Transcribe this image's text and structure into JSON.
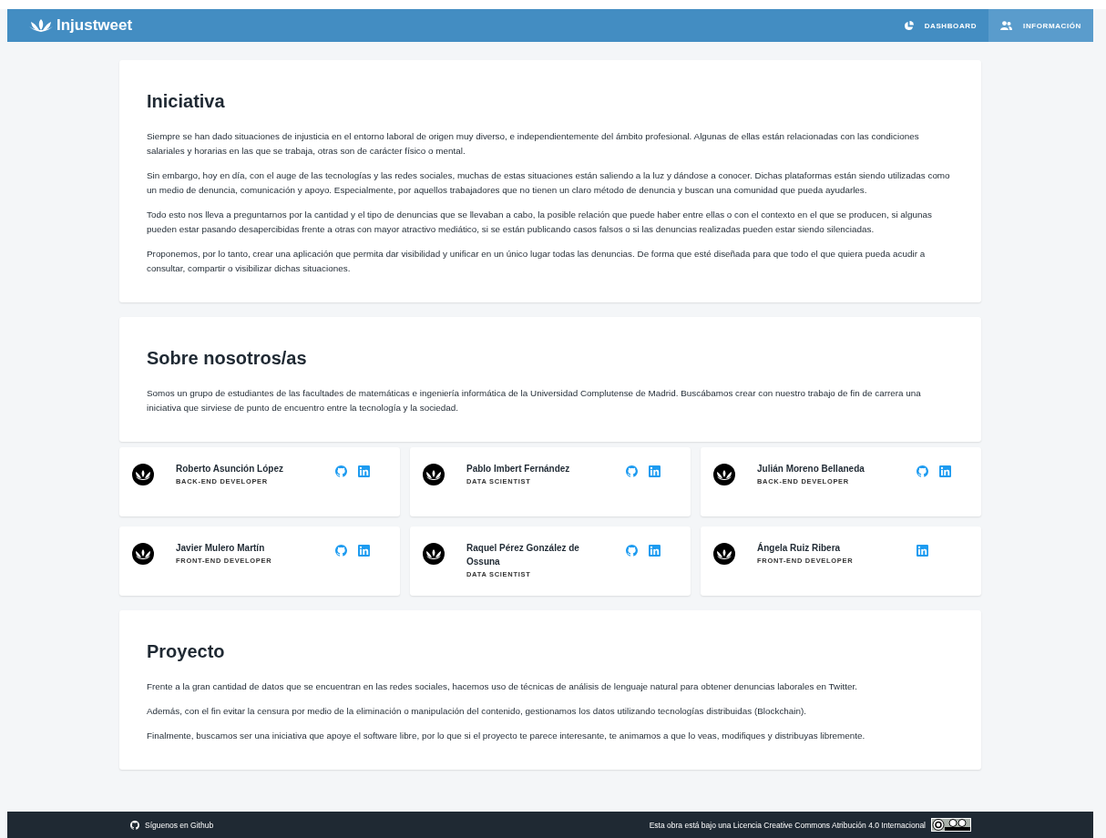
{
  "header": {
    "brand": "Injustweet",
    "nav": [
      {
        "label": "DASHBOARD",
        "kind": "chart",
        "selected": false
      },
      {
        "label": "INFORMACIÓN",
        "kind": "people",
        "selected": true
      }
    ]
  },
  "sections": [
    {
      "title": "Iniciativa",
      "paragraphs": [
        "Siempre se han dado situaciones de injusticia en el entorno laboral de origen muy diverso, e independientemente del ámbito profesional. Algunas de ellas están relacionadas con las condiciones salariales y horarias en las que se trabaja, otras son de carácter físico o mental.",
        "Sin embargo, hoy en día, con el auge de las tecnologías y las redes sociales, muchas de estas situaciones están saliendo a la luz y dándose a conocer. Dichas plataformas están siendo utilizadas como un medio de denuncia, comunicación y apoyo. Especialmente, por aquellos trabajadores que no tienen un claro método de denuncia y buscan una comunidad que pueda ayudarles.",
        "Todo esto nos lleva a preguntarnos por la cantidad y el tipo de denuncias que se llevaban a cabo, la posible relación que puede haber entre ellas o con el contexto en el que se producen, si algunas pueden estar pasando desapercibidas frente a otras con mayor atractivo mediático, si se están publicando casos falsos o si las denuncias realizadas pueden estar siendo silenciadas.",
        "Proponemos, por lo tanto, crear una aplicación que permita dar visibilidad y unificar en un único lugar todas las denuncias. De forma que esté diseñada para que todo el que quiera pueda acudir a consultar, compartir o visibilizar dichas situaciones."
      ]
    },
    {
      "title": "Sobre nosotros/as",
      "paragraphs": [
        "Somos un grupo de estudiantes de las facultades de matemáticas e ingeniería informática de la Universidad Complutense de Madrid. Buscábamos crear con nuestro trabajo de fin de carrera una iniciativa que sirviese de punto de encuentro entre la tecnología y la sociedad."
      ],
      "team": [
        {
          "name": "Roberto Asunción López",
          "role": "BACK-END DEVELOPER",
          "links": [
            {
              "kind": "github"
            },
            {
              "kind": "linkedin"
            }
          ]
        },
        {
          "name": "Pablo Imbert Fernández",
          "role": "DATA SCIENTIST",
          "links": [
            {
              "kind": "github"
            },
            {
              "kind": "linkedin"
            }
          ]
        },
        {
          "name": "Julián Moreno Bellaneda",
          "role": "BACK-END DEVELOPER",
          "links": [
            {
              "kind": "github"
            },
            {
              "kind": "linkedin"
            }
          ]
        },
        {
          "name": "Javier Mulero Martín",
          "role": "FRONT-END DEVELOPER",
          "links": [
            {
              "kind": "github"
            },
            {
              "kind": "linkedin"
            }
          ]
        },
        {
          "name": "Raquel Pérez González de Ossuna",
          "role": "DATA SCIENTIST",
          "links": [
            {
              "kind": "github"
            },
            {
              "kind": "linkedin"
            }
          ]
        },
        {
          "name": "Ángela Ruiz Ribera",
          "role": "FRONT-END DEVELOPER",
          "links": [
            {
              "kind": "linkedin"
            }
          ]
        }
      ]
    },
    {
      "title": "Proyecto",
      "paragraphs": [
        "Frente a la gran cantidad de datos que se encuentran en las redes sociales, hacemos uso de técnicas de análisis de lenguaje natural para obtener denuncias laborales en Twitter.",
        "Además, con el fin evitar la censura por medio de la eliminación o manipulación del contenido, gestionamos los datos utilizando tecnologías distribuidas (Blockchain).",
        "Finalmente, buscamos ser una iniciativa que apoye el software libre, por lo que si el proyecto te parece interesante, te animamos a que lo veas, modifiques y distribuyas libremente."
      ]
    }
  ],
  "footer": {
    "github_link": "Síguenos en Github",
    "license": "Esta obra está bajo una Licencia Creative Commons Atribución 4.0 Internacional"
  }
}
